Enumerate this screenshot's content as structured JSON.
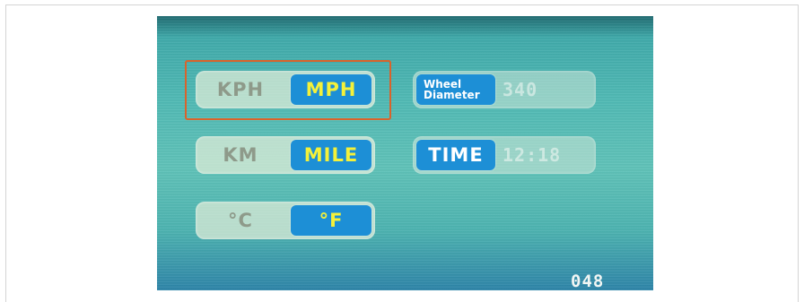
{
  "speed_unit": {
    "off_label": "KPH",
    "on_label": "MPH"
  },
  "distance_unit": {
    "off_label": "KM",
    "on_label": "MILE"
  },
  "temperature_unit": {
    "off_label": "°C",
    "on_label": "°F"
  },
  "wheel_diameter": {
    "label_line1": "Wheel",
    "label_line2": "Diameter",
    "value": "340"
  },
  "time": {
    "label": "TIME",
    "value": "12:18"
  },
  "page_number": "048",
  "colors": {
    "selected_background": "#1d8fd6",
    "selected_text": "#f4f13a",
    "selection_outline": "#d9632b",
    "screen_background": "#4fb9b4"
  }
}
